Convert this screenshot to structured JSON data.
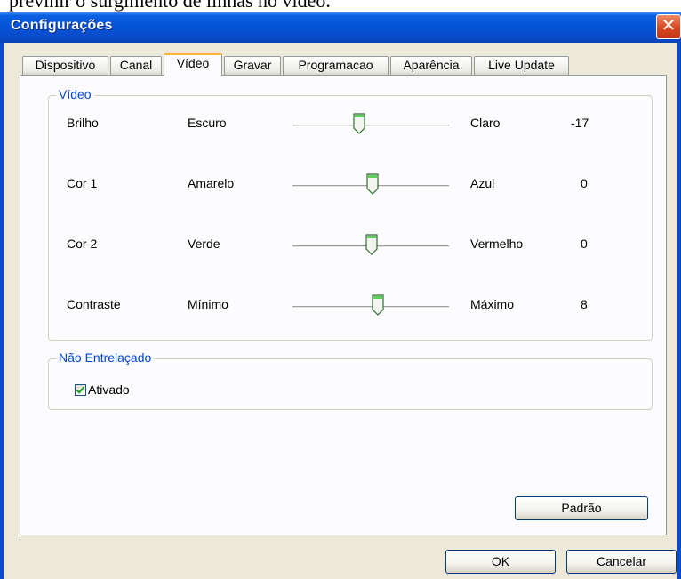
{
  "caption": "previnir o surgimento de linhas no vídeo.",
  "window": {
    "title": "Configurações"
  },
  "tabs": [
    {
      "label": "Dispositivo"
    },
    {
      "label": "Canal"
    },
    {
      "label": "Vídeo"
    },
    {
      "label": "Gravar"
    },
    {
      "label": "Programacao"
    },
    {
      "label": "Aparência"
    },
    {
      "label": "Live Update"
    }
  ],
  "active_tab": "Vídeo",
  "video_group": {
    "legend": "Vídeo",
    "rows": [
      {
        "name": "Brilho",
        "min_label": "Escuro",
        "max_label": "Claro",
        "value": "-17"
      },
      {
        "name": "Cor 1",
        "min_label": "Amarelo",
        "max_label": "Azul",
        "value": "0"
      },
      {
        "name": "Cor 2",
        "min_label": "Verde",
        "max_label": "Vermelho",
        "value": "0"
      },
      {
        "name": "Contraste",
        "min_label": "Mínimo",
        "max_label": "Máximo",
        "value": "8"
      }
    ]
  },
  "interlace_group": {
    "legend": "Não Entrelaçado",
    "checkbox_label": "Ativado",
    "checked": true
  },
  "buttons": {
    "default": "Padrão",
    "ok": "OK",
    "cancel": "Cancelar"
  },
  "colors": {
    "titlebar": "#0a4ccb",
    "legend_text": "#0046d5",
    "active_tab_accent": "#f7b538",
    "checkmark": "#21a121"
  }
}
